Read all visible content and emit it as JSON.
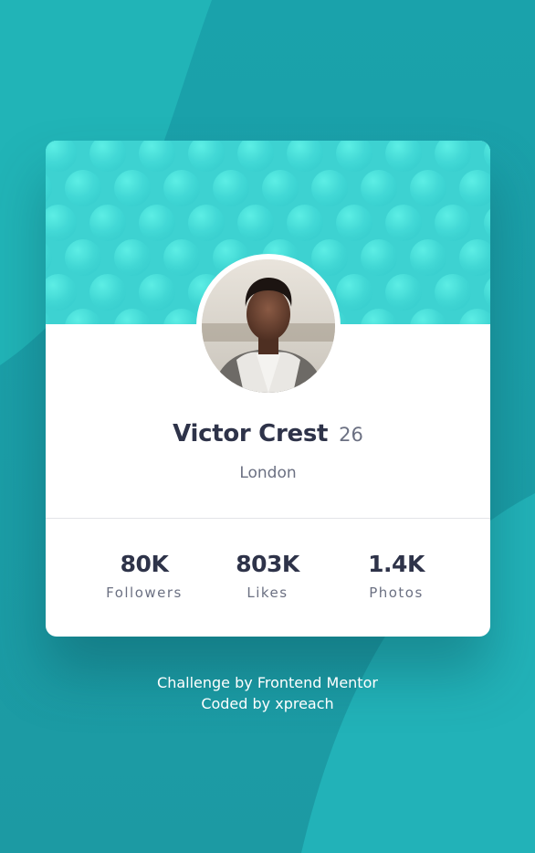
{
  "colors": {
    "page_background": "#1ea0aa",
    "header_accent": "#3fd3d2",
    "text_dark": "#2e3349",
    "text_muted": "#6b7082",
    "card_background": "#ffffff"
  },
  "profile": {
    "name": "Victor Crest",
    "age": "26",
    "location": "London",
    "avatar_icon": "profile-photo"
  },
  "stats": [
    {
      "value": "80K",
      "label": "Followers"
    },
    {
      "value": "803K",
      "label": "Likes"
    },
    {
      "value": "1.4K",
      "label": "Photos"
    }
  ],
  "attribution": {
    "line1": "Challenge by Frontend Mentor",
    "line2": "Coded by xpreach"
  }
}
